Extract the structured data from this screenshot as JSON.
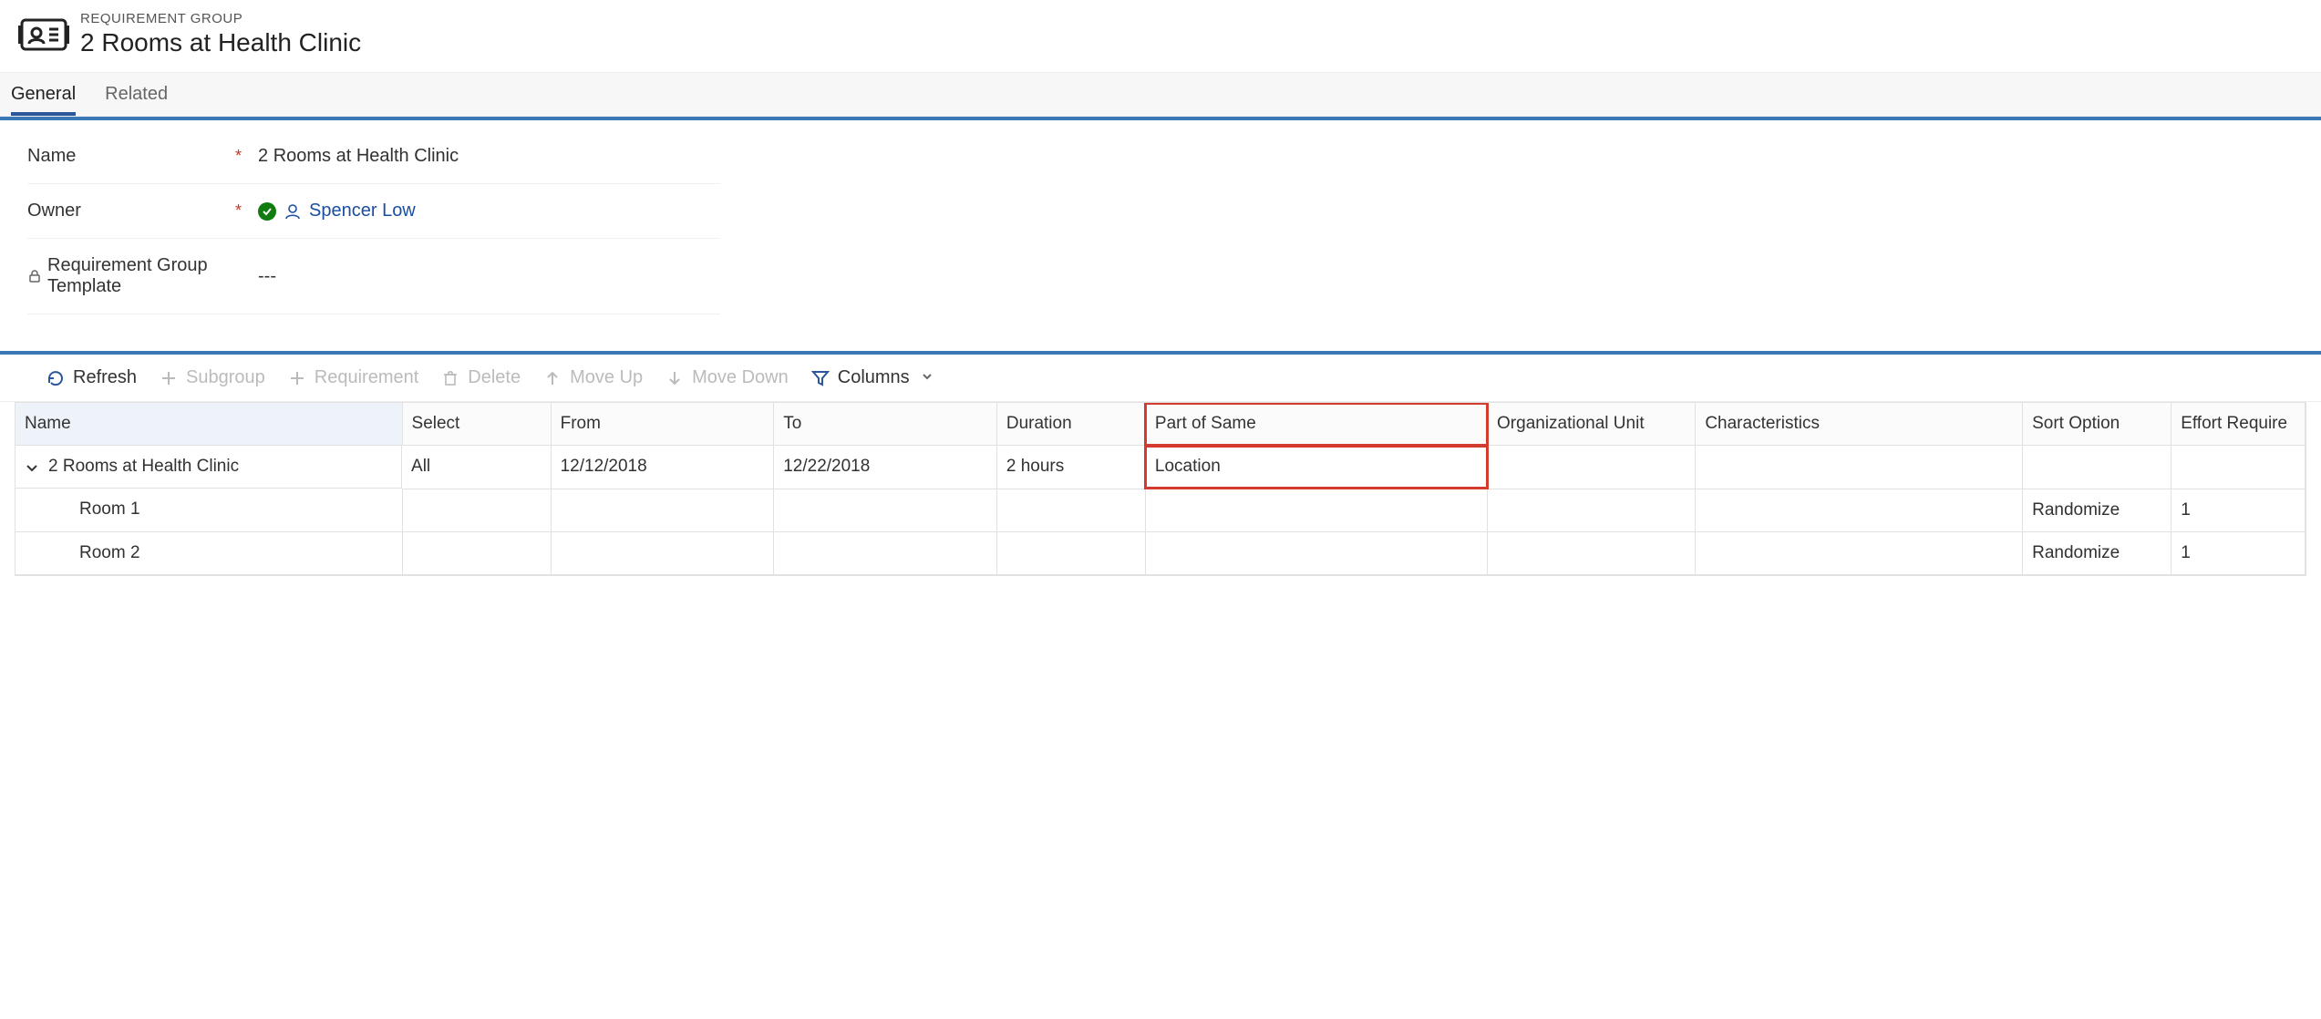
{
  "header": {
    "type_label": "REQUIREMENT GROUP",
    "title": "2 Rooms at Health Clinic"
  },
  "tabs": {
    "general": "General",
    "related": "Related"
  },
  "form": {
    "name_label": "Name",
    "name_value": "2 Rooms at Health Clinic",
    "owner_label": "Owner",
    "owner_value": "Spencer Low",
    "template_label": "Requirement Group Template",
    "template_value": "---"
  },
  "toolbar": {
    "refresh": "Refresh",
    "subgroup": "Subgroup",
    "requirement": "Requirement",
    "delete": "Delete",
    "moveup": "Move Up",
    "movedown": "Move Down",
    "columns": "Columns"
  },
  "grid": {
    "columns": {
      "name": "Name",
      "select": "Select",
      "from": "From",
      "to": "To",
      "duration": "Duration",
      "part_of_same": "Part of Same",
      "org_unit": "Organizational Unit",
      "characteristics": "Characteristics",
      "sort_option": "Sort Option",
      "effort_required": "Effort Require"
    },
    "rows": [
      {
        "name": "2 Rooms at Health Clinic",
        "select": "All",
        "from": "12/12/2018",
        "to": "12/22/2018",
        "duration": "2 hours",
        "part_of_same": "Location",
        "org_unit": "",
        "characteristics": "",
        "sort_option": "",
        "effort_required": "",
        "level": 0,
        "expandable": true
      },
      {
        "name": "Room 1",
        "select": "",
        "from": "",
        "to": "",
        "duration": "",
        "part_of_same": "",
        "org_unit": "",
        "characteristics": "",
        "sort_option": "Randomize",
        "effort_required": "1",
        "level": 1,
        "expandable": false
      },
      {
        "name": "Room 2",
        "select": "",
        "from": "",
        "to": "",
        "duration": "",
        "part_of_same": "",
        "org_unit": "",
        "characteristics": "",
        "sort_option": "Randomize",
        "effort_required": "1",
        "level": 1,
        "expandable": false
      }
    ]
  }
}
